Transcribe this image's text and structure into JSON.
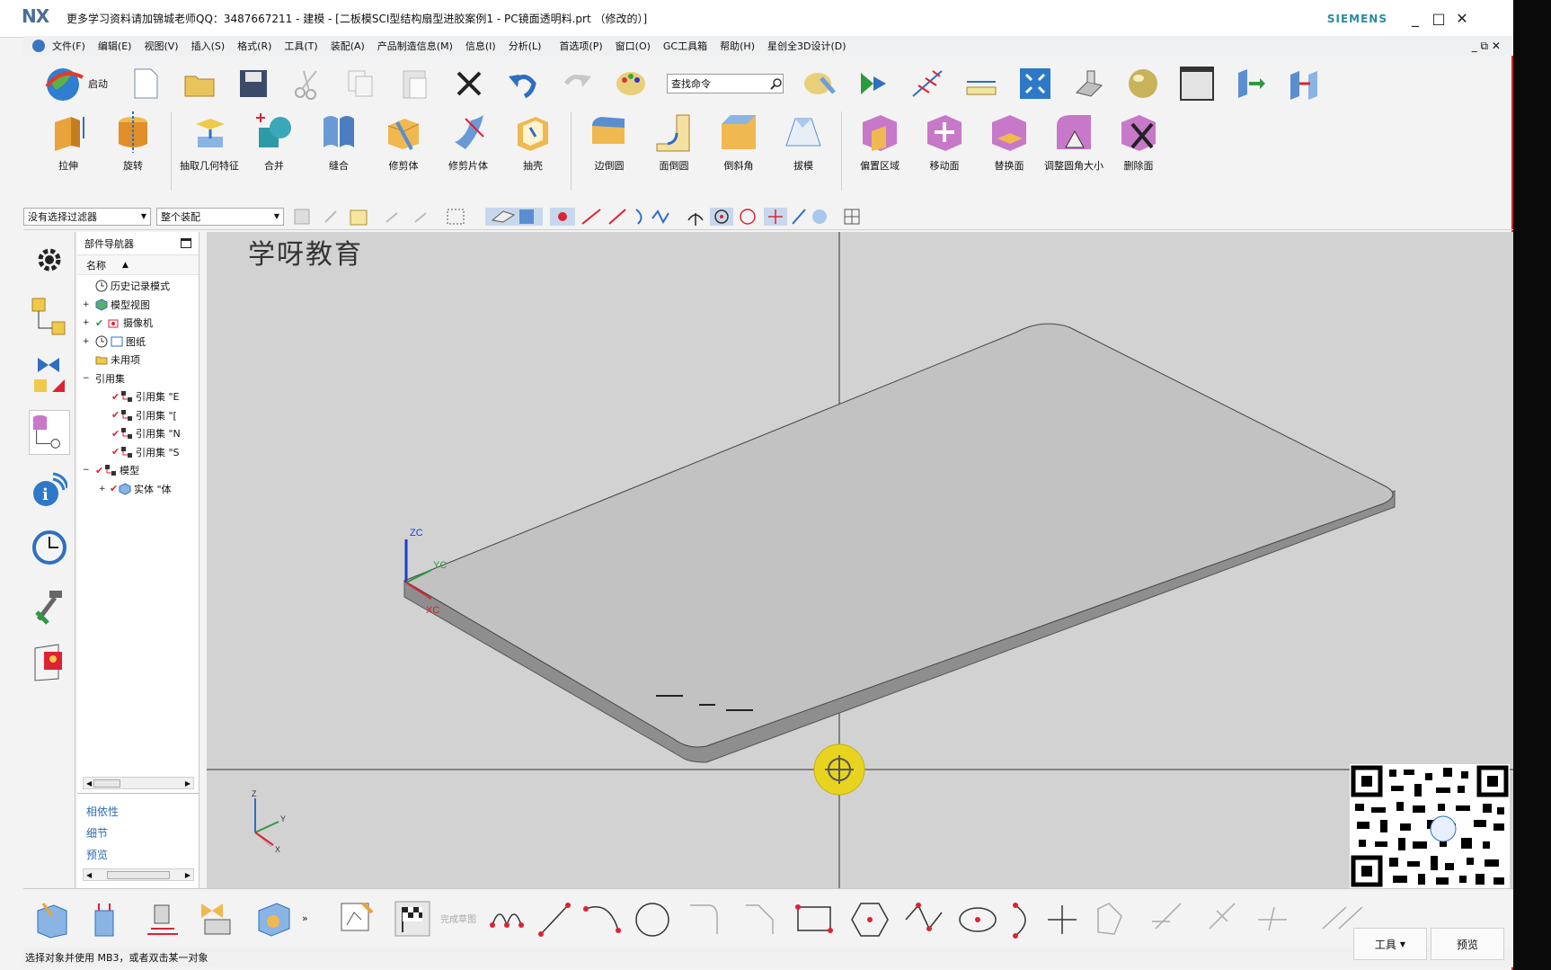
{
  "window": {
    "logo": "NX",
    "title": "更多学习资料请加锦城老师QQ：3487667211 - 建模 - [二板模SCI型结构扇型进胶案例1 - PC镜面透明料.prt （修改的）]",
    "brand": "SIEMENS",
    "min": "_",
    "max": "□",
    "close": "✕"
  },
  "menu": {
    "items": [
      "文件(F)",
      "编辑(E)",
      "视图(V)",
      "插入(S)",
      "格式(R)",
      "工具(T)",
      "装配(A)",
      "产品制造信息(M)",
      "信息(I)",
      "分析(L)",
      "首选项(P)",
      "窗口(O)",
      "GC工具箱",
      "帮助(H)",
      "星创全3D设计(D)"
    ],
    "right": "_ ⧉ ✕"
  },
  "toolbar1": {
    "start_label": "启动",
    "search_placeholder": "查找命令"
  },
  "features": {
    "items": [
      "拉伸",
      "旋转",
      "抽取几何特征",
      "合并",
      "缝合",
      "修剪体",
      "修剪片体",
      "抽壳",
      "边倒圆",
      "面倒圆",
      "倒斜角",
      "拔模",
      "偏置区域",
      "移动面",
      "替换面",
      "调整圆角大小",
      "删除面"
    ]
  },
  "filters": {
    "selection_filter": "没有选择过滤器",
    "assembly_scope": "整个装配"
  },
  "navigator": {
    "title": "部件导航器",
    "column": "名称",
    "rows": [
      {
        "text": "历史记录模式"
      },
      {
        "text": "模型视图"
      },
      {
        "text": "摄像机"
      },
      {
        "text": "图纸"
      },
      {
        "text": "未用项"
      },
      {
        "text": "引用集"
      },
      {
        "text": "引用集 \"E"
      },
      {
        "text": "引用集 \"[",
        "note": ""
      },
      {
        "text": "引用集 \"N"
      },
      {
        "text": "引用集 \"S"
      },
      {
        "text": "模型"
      },
      {
        "text": "实体 \"体"
      }
    ],
    "footer": [
      "相依性",
      "细节",
      "预览"
    ]
  },
  "viewport": {
    "watermark": "学呀教育",
    "axis_labels": {
      "zc": "ZC",
      "yc": "YC",
      "xc": "XC"
    },
    "triad": {
      "z": "Z",
      "y": "Y",
      "x": "X"
    }
  },
  "bottom": {
    "sketch_done": "完成草图"
  },
  "status": {
    "prompt": "选择对象并使用 MB3，或者双击某一对象",
    "tools": "工具",
    "preview": "预览"
  },
  "colors": {
    "viewport_bg": "#d2d2d2",
    "plate_top": "#c2c2c2",
    "plate_side": "#8e8e8e",
    "link_blue": "#2a6cb0"
  }
}
